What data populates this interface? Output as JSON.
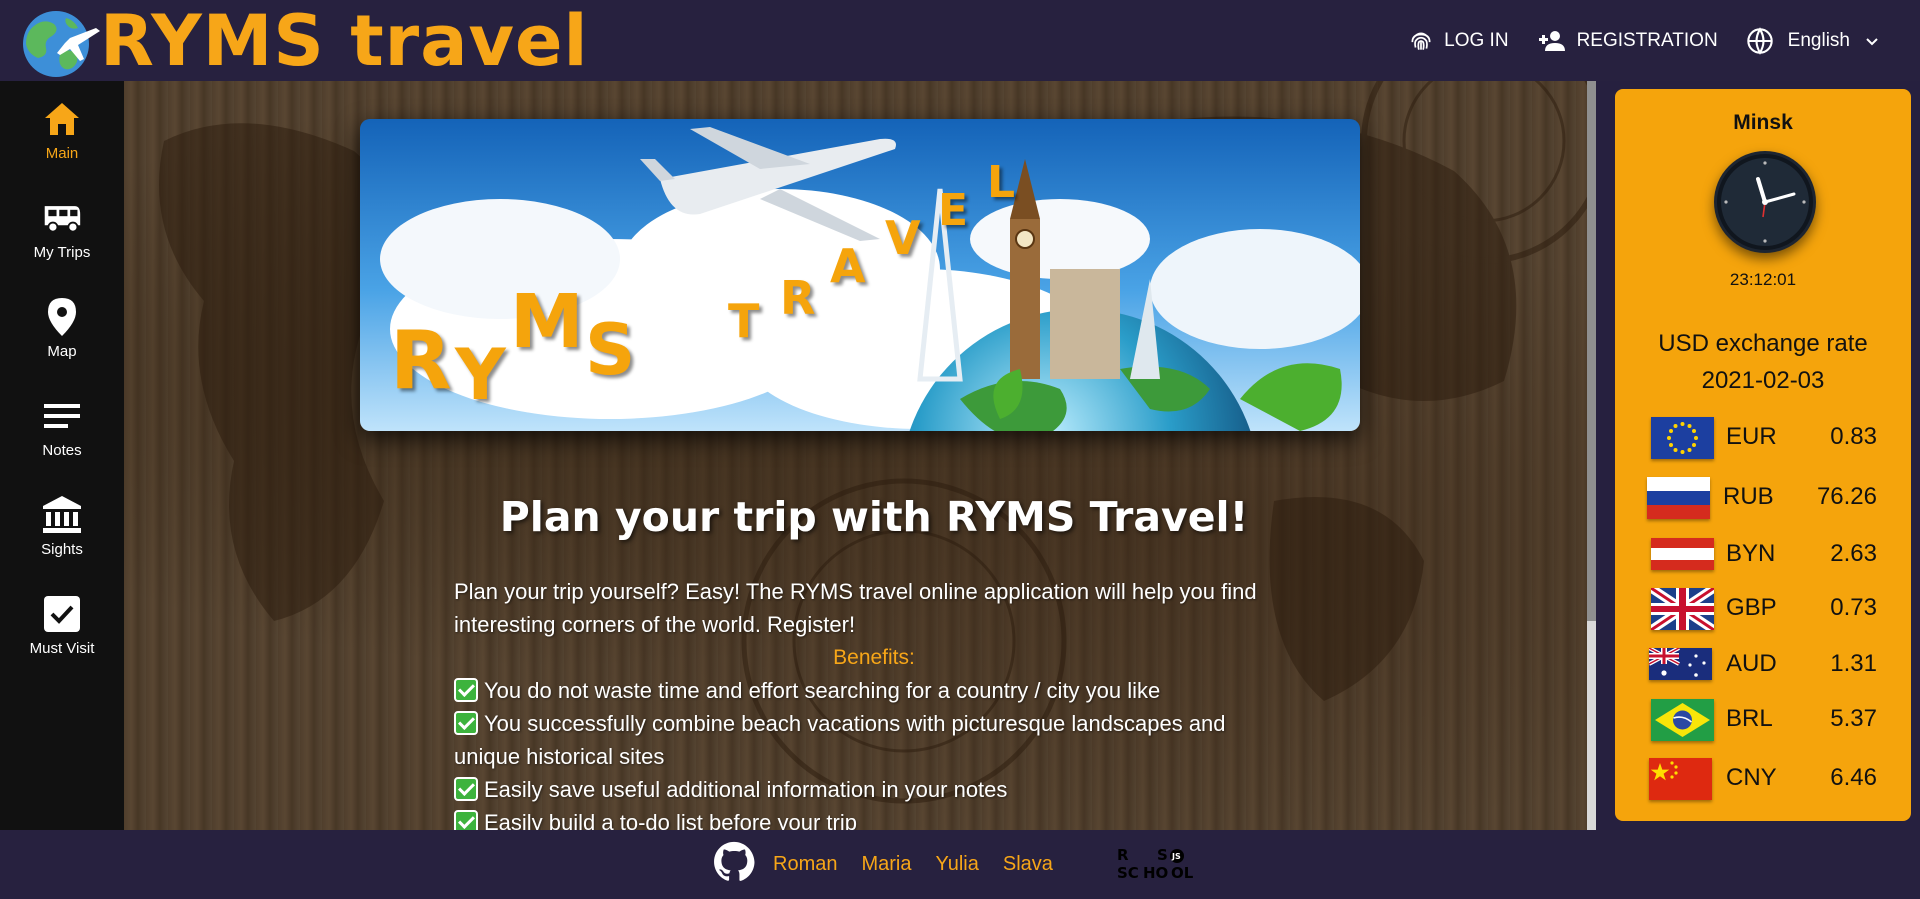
{
  "header": {
    "logo_text": "RYMS travel",
    "login": "LOG IN",
    "registration": "REGISTRATION",
    "language": "English",
    "accent": "#f7a618"
  },
  "sidebar": {
    "items": [
      {
        "label": "Main",
        "icon": "home-icon",
        "active": true
      },
      {
        "label": "My Trips",
        "icon": "bus-icon"
      },
      {
        "label": "Map",
        "icon": "map-pin-icon"
      },
      {
        "label": "Notes",
        "icon": "notes-icon"
      },
      {
        "label": "Sights",
        "icon": "museum-icon"
      },
      {
        "label": "Must Visit",
        "icon": "checkbox-icon"
      }
    ]
  },
  "main": {
    "banner_letters": [
      "R",
      "Y",
      "M",
      "S",
      "T",
      "R",
      "A",
      "V",
      "E",
      "L"
    ],
    "title": "Plan your trip with RYMS Travel!",
    "intro": "Plan your trip yourself? Easy! The RYMS travel online application will help you find interesting corners of the world. Register!",
    "benefits_title": "Benefits:",
    "benefits": [
      "You do not waste time and effort searching for a country / city you like",
      "You successfully combine beach vacations with picturesque landscapes and unique historical sites",
      "Easily save useful additional information in your notes",
      "Easily build a to-do list before your trip"
    ]
  },
  "widget": {
    "city": "Minsk",
    "time": "23:12:01",
    "rate_title": "USD exchange rate",
    "rate_date": "2021-02-03",
    "rates": [
      {
        "code": "EUR",
        "value": "0.83"
      },
      {
        "code": "RUB",
        "value": "76.26"
      },
      {
        "code": "BYN",
        "value": "2.63"
      },
      {
        "code": "GBP",
        "value": "0.73"
      },
      {
        "code": "AUD",
        "value": "1.31"
      },
      {
        "code": "BRL",
        "value": "5.37"
      },
      {
        "code": "CNY",
        "value": "6.46"
      }
    ]
  },
  "footer": {
    "authors": [
      "Roman",
      "Maria",
      "Yulia",
      "Slava"
    ],
    "school_logo": "RS SCHOOL"
  }
}
